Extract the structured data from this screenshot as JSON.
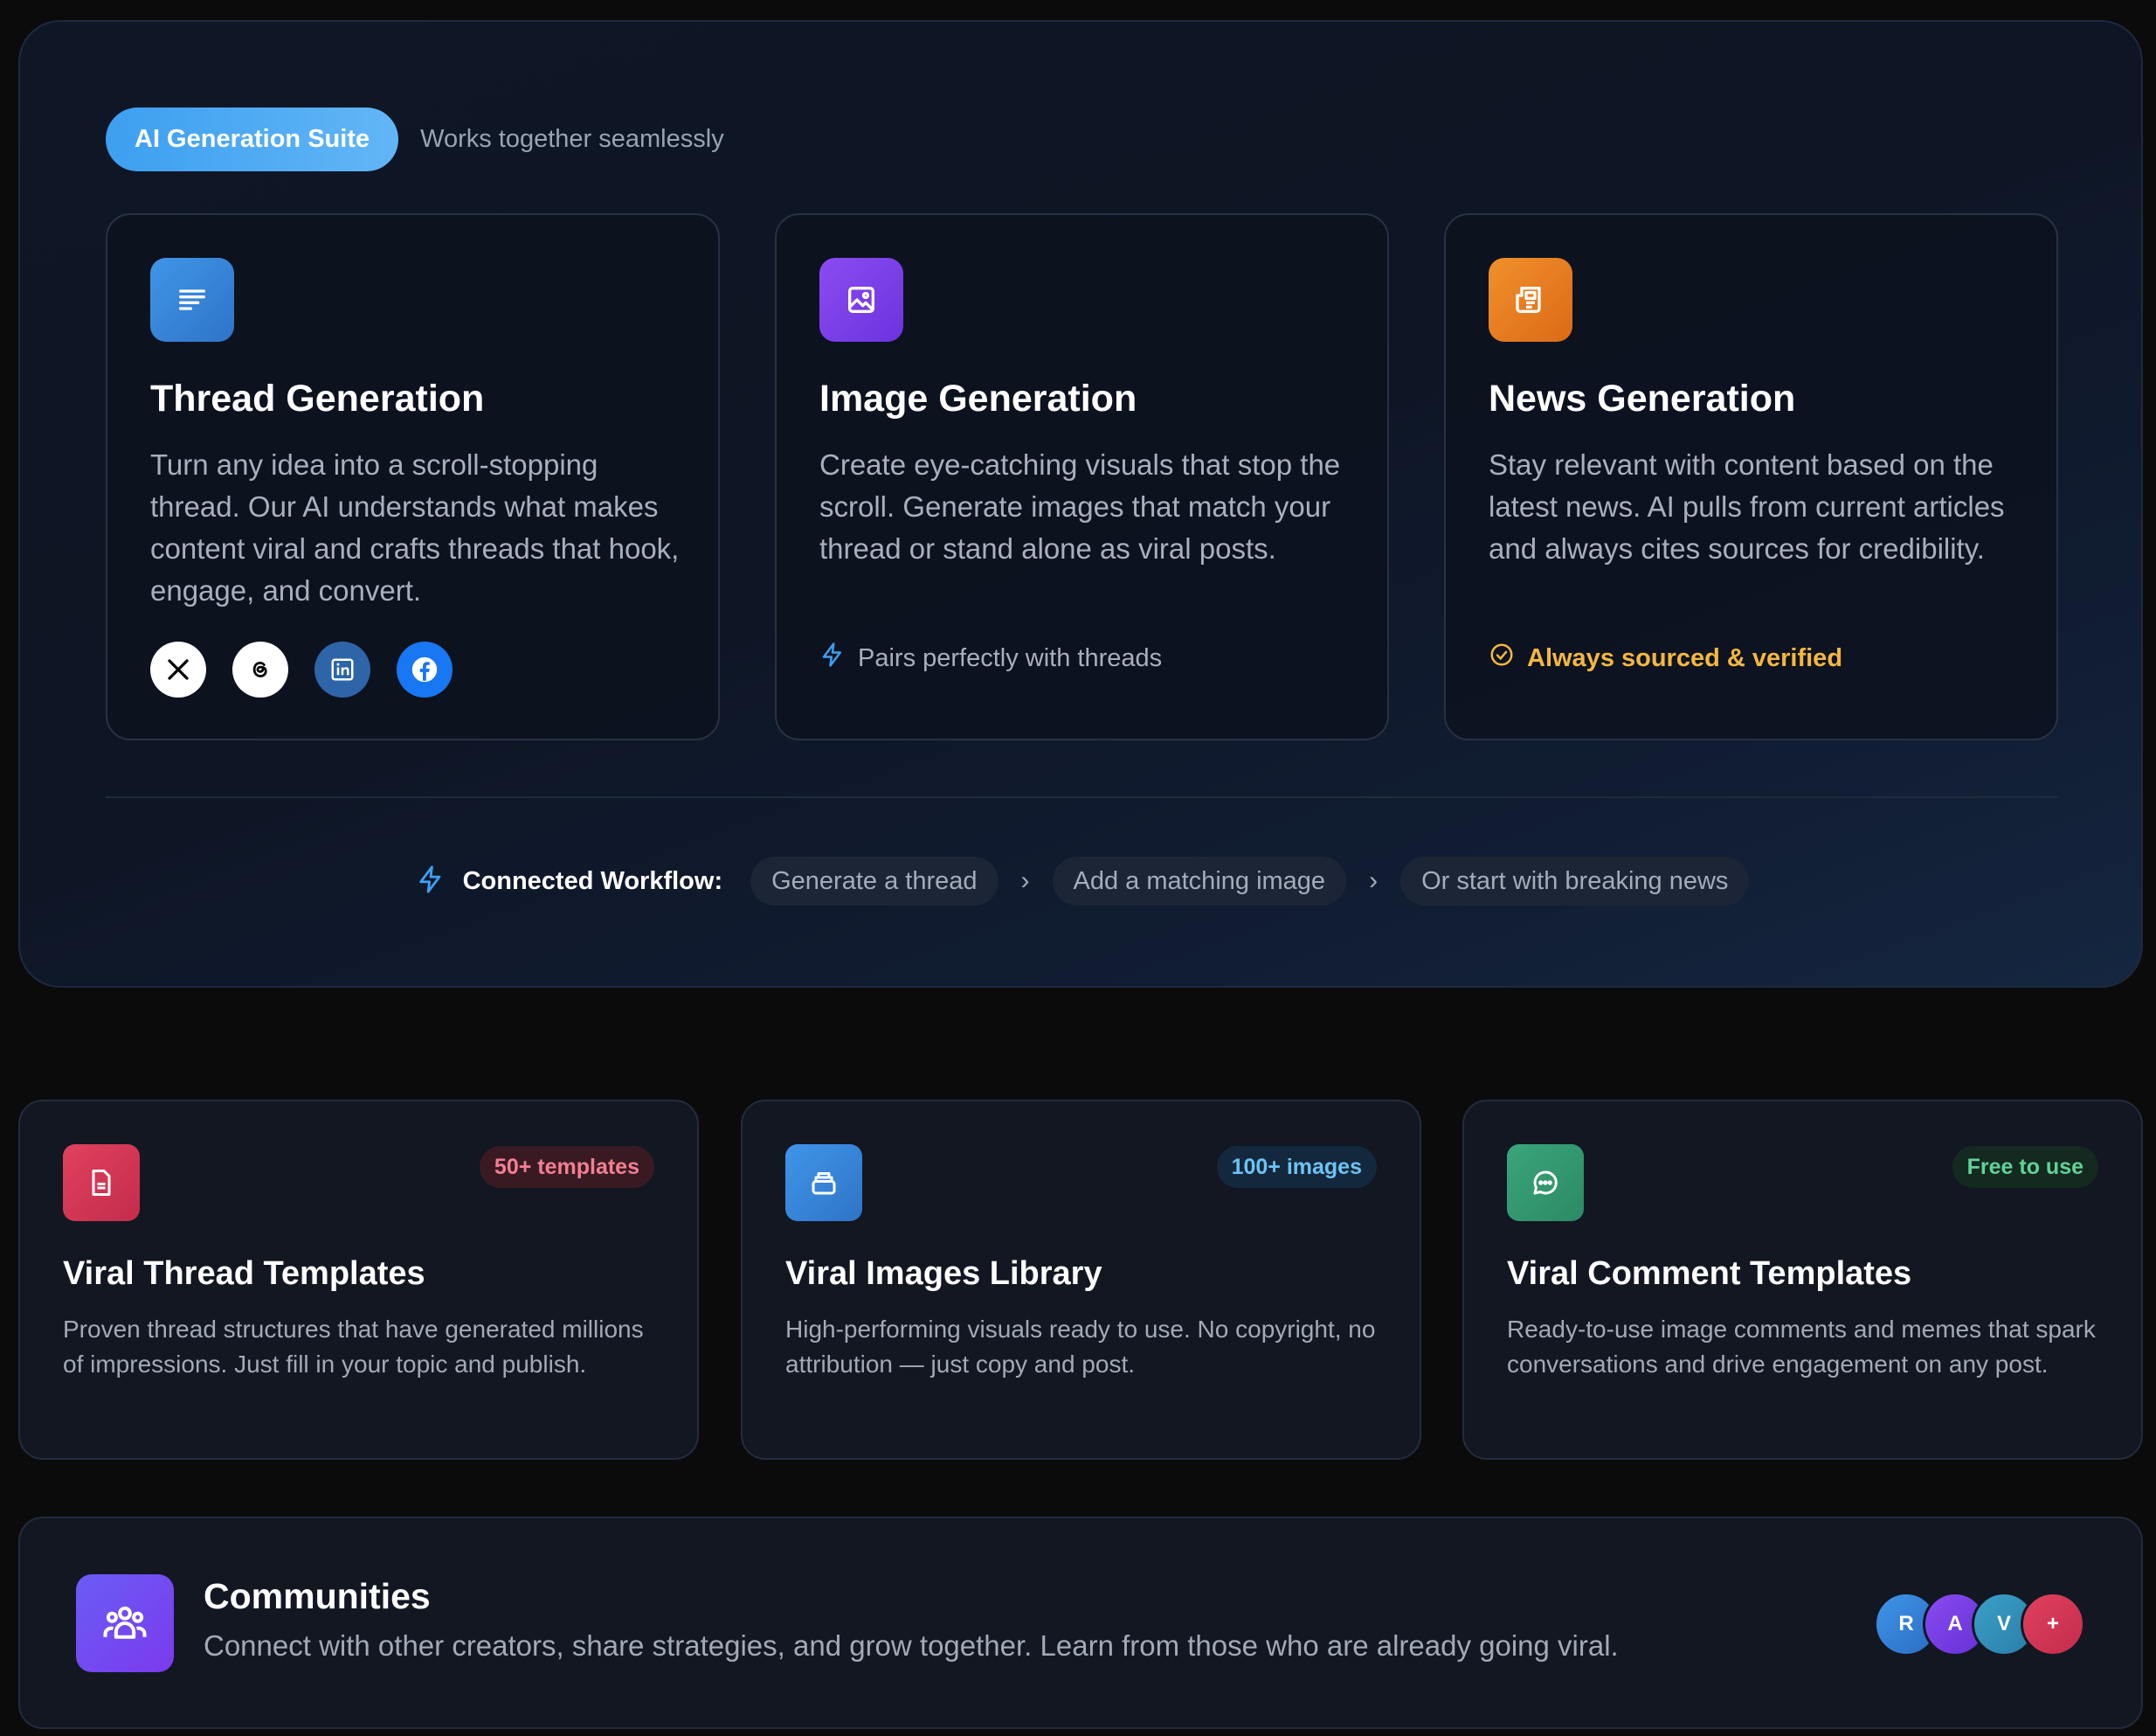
{
  "suite": {
    "pill": "AI Generation Suite",
    "subtitle": "Works together seamlessly",
    "cards": [
      {
        "title": "Thread Generation",
        "description": "Turn any idea into a scroll-stopping thread. Our AI understands what makes content viral and crafts threads that hook, engage, and convert.",
        "icon": "lines-icon",
        "socials": [
          "x-icon",
          "threads-icon",
          "linkedin-icon",
          "facebook-icon"
        ]
      },
      {
        "title": "Image Generation",
        "description": "Create eye-catching visuals that stop the scroll. Generate images that match your thread or stand alone as viral posts.",
        "icon": "image-icon",
        "footer": "Pairs perfectly with threads"
      },
      {
        "title": "News Generation",
        "description": "Stay relevant with content based on the latest news. AI pulls from current articles and always cites sources for credibility.",
        "icon": "newspaper-icon",
        "footer": "Always sourced & verified"
      }
    ],
    "workflow": {
      "label": "Connected Workflow:",
      "steps": [
        "Generate a thread",
        "Add a matching image",
        "Or start with breaking news"
      ]
    }
  },
  "features": [
    {
      "title": "Viral Thread Templates",
      "badge": "50+ templates",
      "description": "Proven thread structures that have generated millions of impressions. Just fill in your topic and publish."
    },
    {
      "title": "Viral Images Library",
      "badge": "100+ images",
      "description": "High-performing visuals ready to use. No copyright, no attribution — just copy and post."
    },
    {
      "title": "Viral Comment Templates",
      "badge": "Free to use",
      "description": "Ready-to-use image comments and memes that spark conversations and drive engagement on any post."
    }
  ],
  "community": {
    "title": "Communities",
    "description": "Connect with other creators, share strategies, and grow together. Learn from those who are already going viral.",
    "avatars": [
      "R",
      "A",
      "V",
      "+"
    ]
  },
  "colors": {
    "accent_blue": "#3d9ff0",
    "verified_yellow": "#f5b83d",
    "background": "#0b0b0c"
  }
}
